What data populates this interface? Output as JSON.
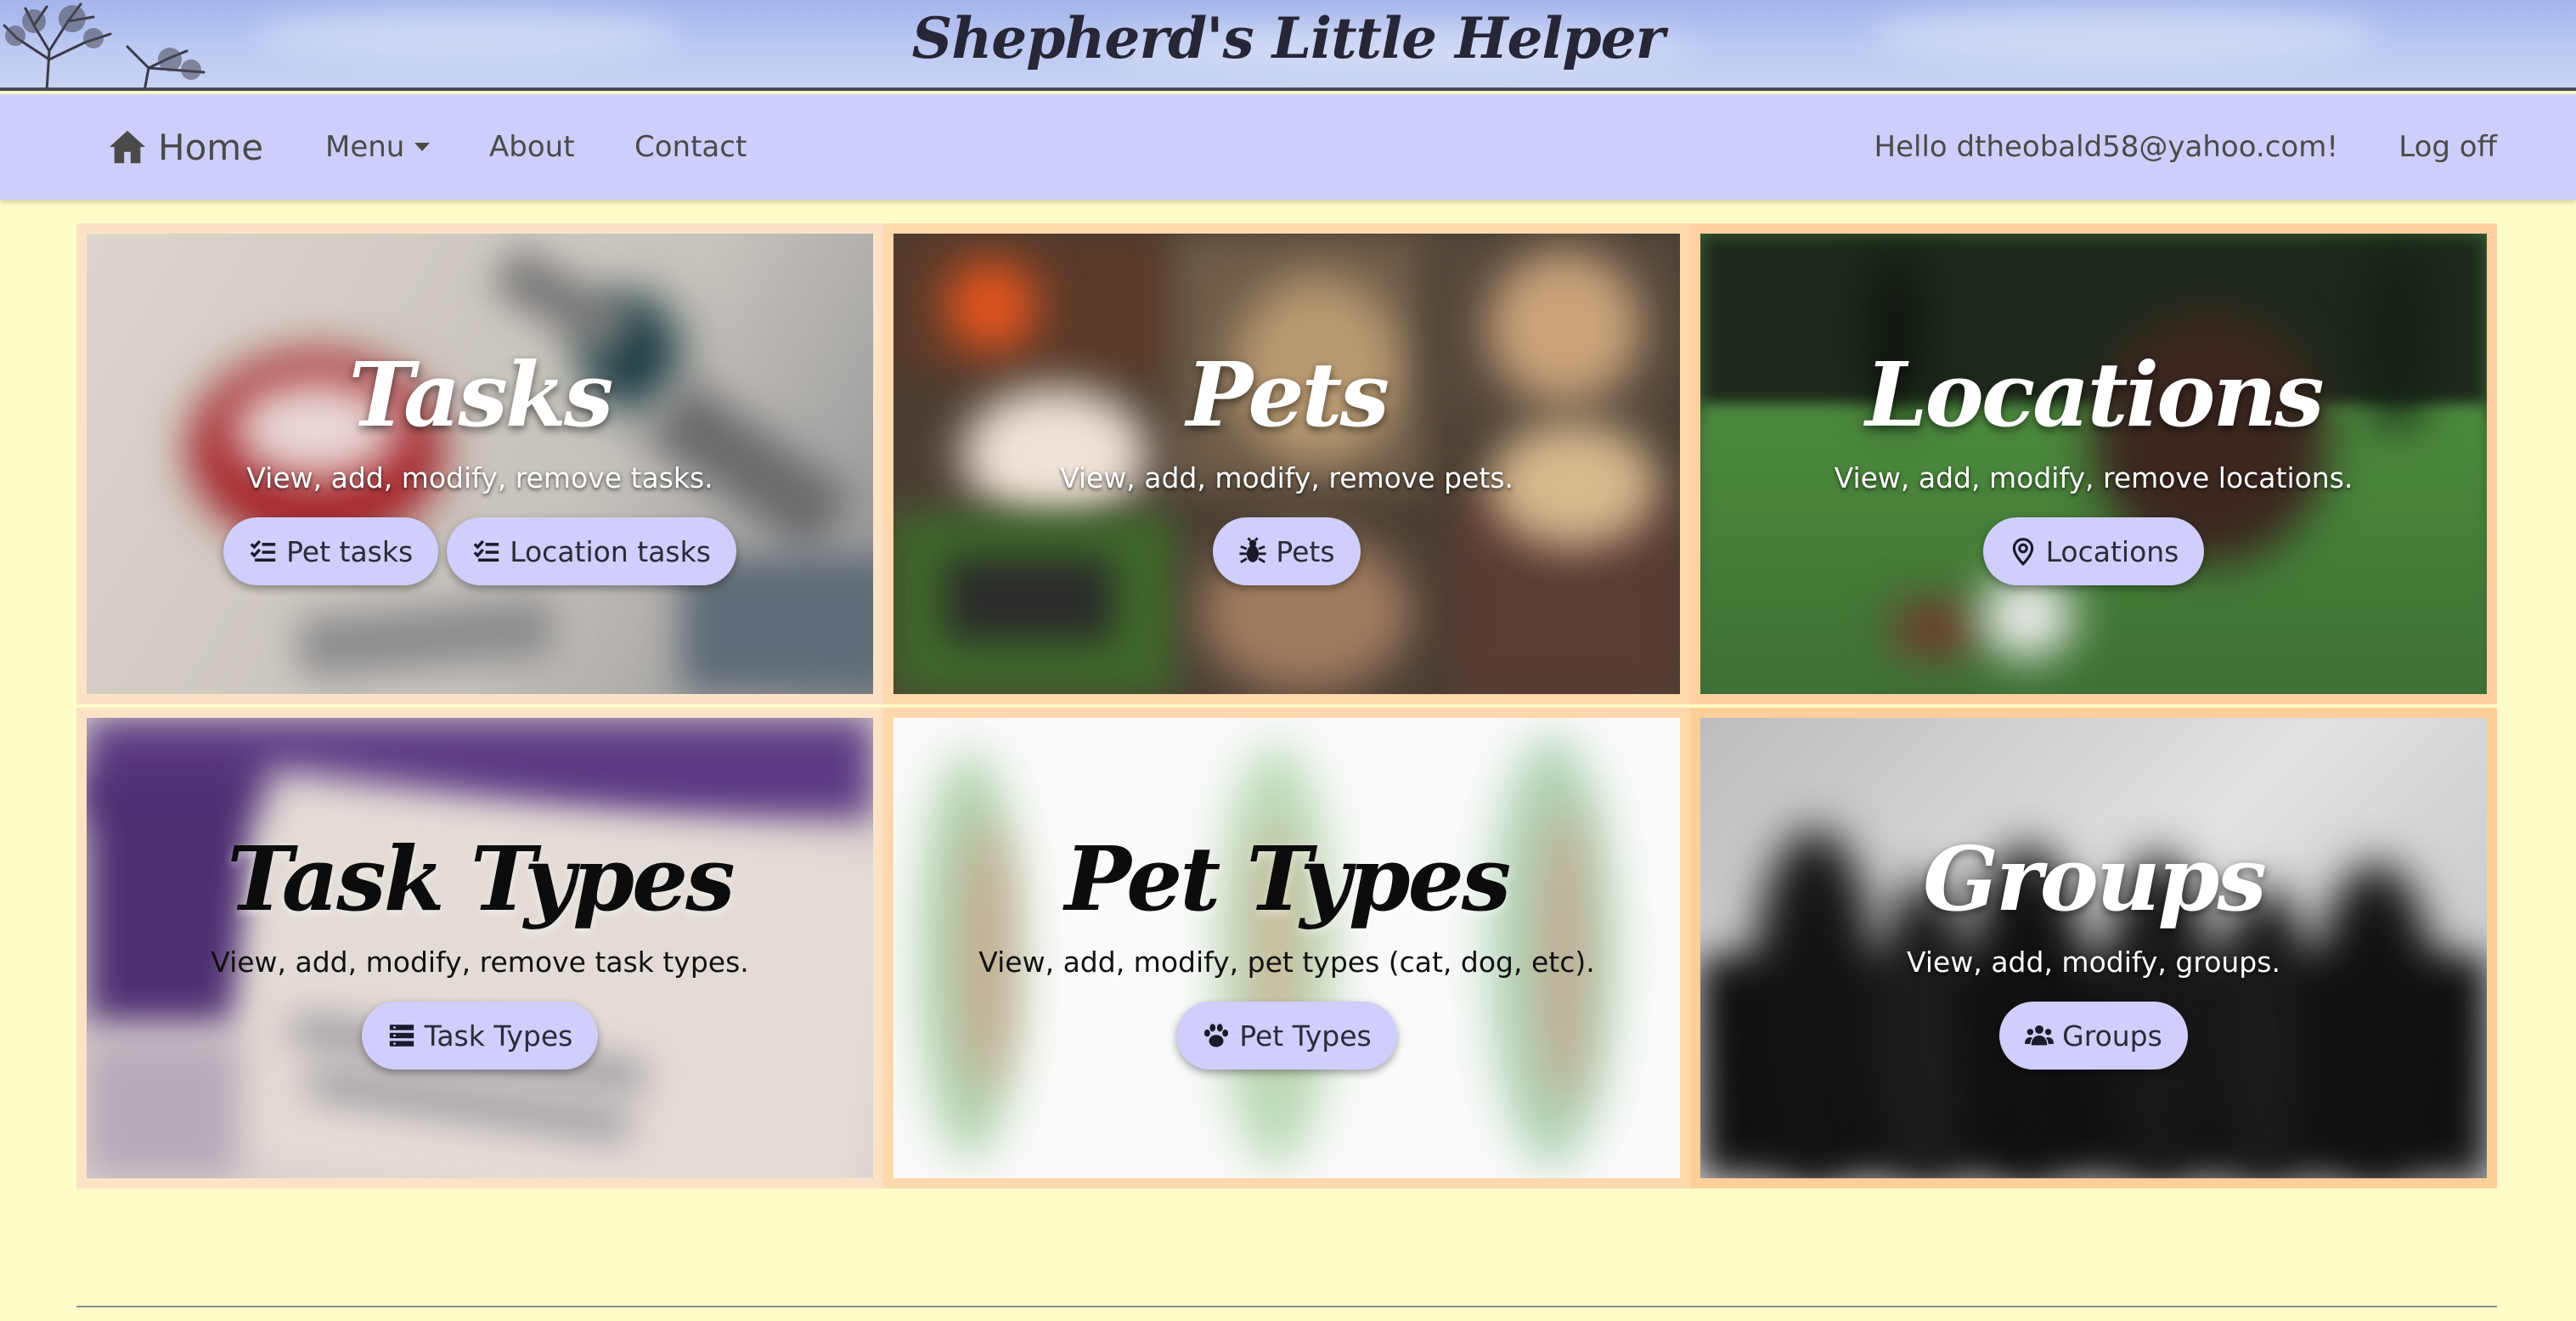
{
  "site": {
    "title": "Shepherd's Little Helper"
  },
  "nav": {
    "home": "Home",
    "menu": "Menu",
    "about": "About",
    "contact": "Contact",
    "greeting": "Hello dtheobald58@yahoo.com!",
    "logoff": "Log off"
  },
  "tiles": [
    {
      "title": "Tasks",
      "description": "View, add, modify, remove tasks.",
      "buttons": [
        {
          "label": "Pet tasks",
          "icon": "checklist-icon"
        },
        {
          "label": "Location tasks",
          "icon": "checklist-icon"
        }
      ]
    },
    {
      "title": "Pets",
      "description": "View, add, modify, remove pets.",
      "buttons": [
        {
          "label": "Pets",
          "icon": "bug-icon"
        }
      ]
    },
    {
      "title": "Locations",
      "description": "View, add, modify, remove locations.",
      "buttons": [
        {
          "label": "Locations",
          "icon": "map-pin-icon"
        }
      ]
    },
    {
      "title": "Task Types",
      "description": "View, add, modify, remove task types.",
      "buttons": [
        {
          "label": "Task Types",
          "icon": "list-icon"
        }
      ]
    },
    {
      "title": "Pet Types",
      "description": "View, add, modify, pet types (cat, dog, etc).",
      "buttons": [
        {
          "label": "Pet Types",
          "icon": "paw-icon"
        }
      ]
    },
    {
      "title": "Groups",
      "description": "View, add, modify, groups.",
      "buttons": [
        {
          "label": "Groups",
          "icon": "users-icon"
        }
      ]
    }
  ],
  "colors": {
    "page_background": "#fefcc8",
    "navbar": "#cecefa",
    "button": "#d0cefa",
    "tile_border": "#fed9ab"
  }
}
